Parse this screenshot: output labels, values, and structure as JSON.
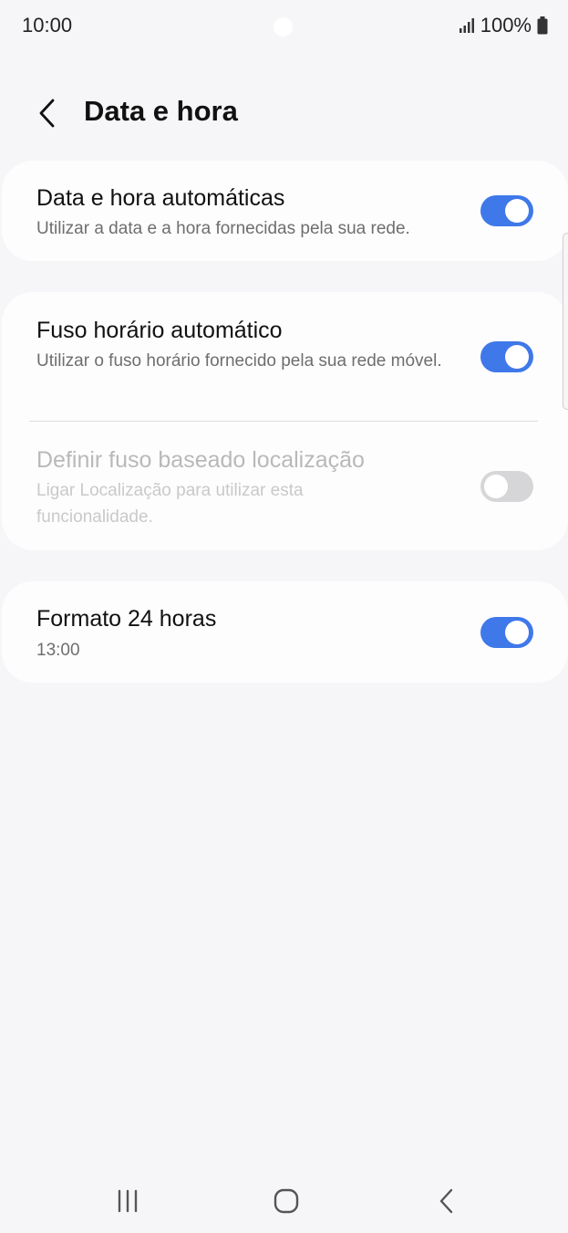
{
  "status_bar": {
    "time": "10:00",
    "battery": "100%",
    "icons": [
      "signal-icon",
      "battery-icon"
    ]
  },
  "header": {
    "back_icon": "chevron-left-icon",
    "title": "Data e hora"
  },
  "settings": {
    "auto_date_time": {
      "title": "Data e hora automáticas",
      "subtitle": "Utilizar a data e a hora fornecidas pela sua rede.",
      "enabled": true
    },
    "auto_timezone": {
      "title": "Fuso horário automático",
      "subtitle": "Utilizar o fuso horário fornecido pela sua rede móvel.",
      "enabled": true
    },
    "location_timezone": {
      "title": "Definir fuso baseado localização",
      "subtitle": "Ligar Localização para utilizar esta funcionalidade.",
      "enabled": false,
      "disabled": true
    },
    "format_24h": {
      "title": "Formato 24 horas",
      "subtitle": "13:00",
      "enabled": true
    }
  },
  "colors": {
    "accent": "#3f78e9",
    "background": "#f6f6f8",
    "card": "#fdfdfe"
  },
  "nav_bar": {
    "icons": [
      "recents-icon",
      "home-icon",
      "back-icon"
    ]
  }
}
